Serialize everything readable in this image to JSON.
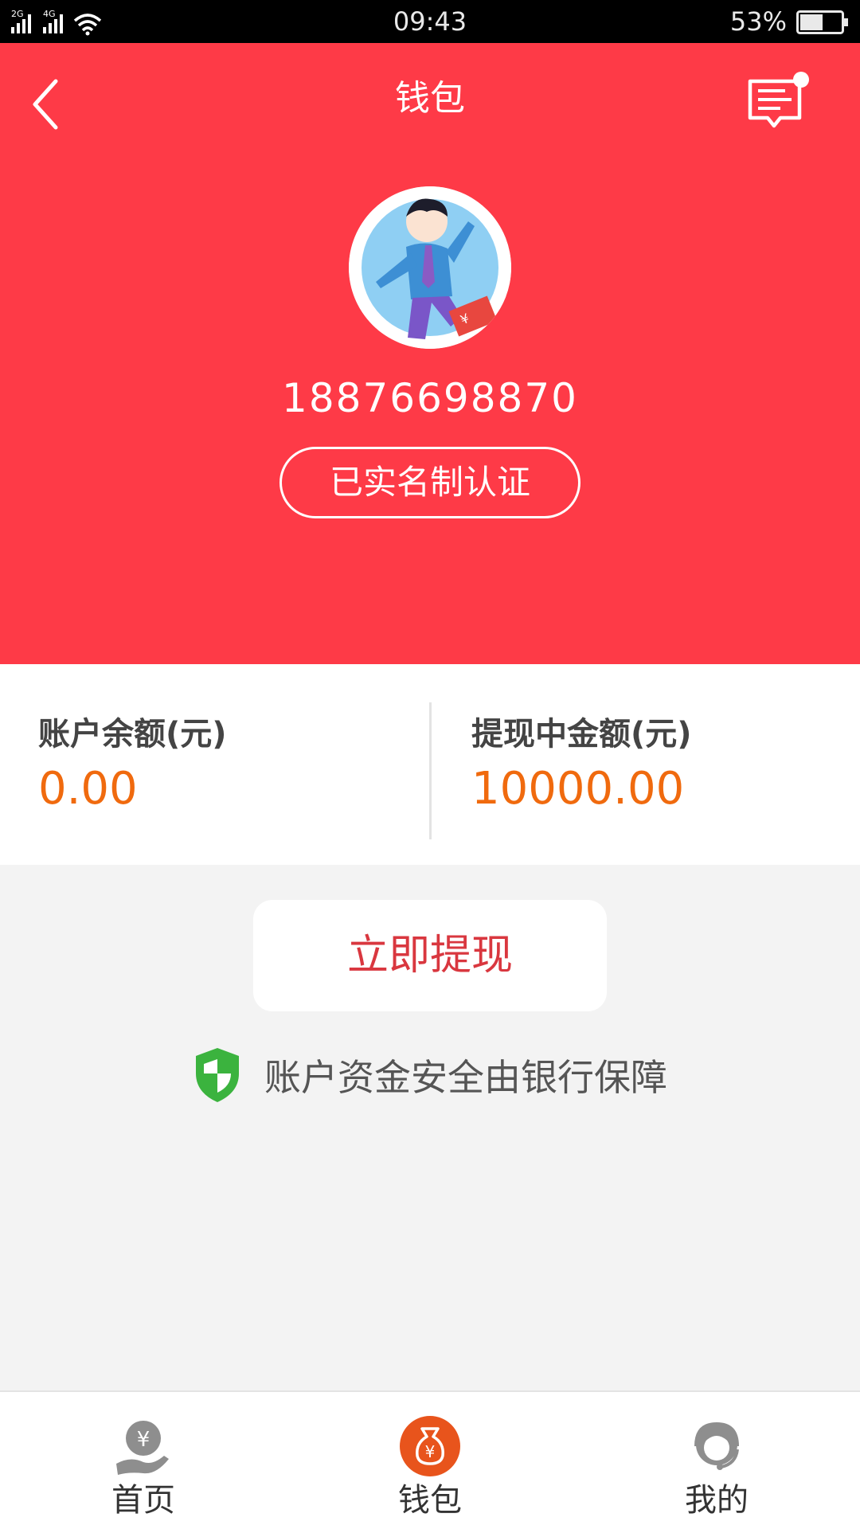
{
  "status_bar": {
    "signal_1": "2G",
    "signal_2": "4G",
    "time": "09:43",
    "battery_percent": "53%"
  },
  "header": {
    "title": "钱包",
    "phone": "18876698870",
    "verify_label": "已实名制认证"
  },
  "balance": {
    "account_label": "账户余额(元)",
    "account_value": "0.00",
    "withdrawing_label": "提现中金额(元)",
    "withdrawing_value": "10000.00"
  },
  "actions": {
    "withdraw_label": "立即提现"
  },
  "security": {
    "text": "账户资金安全由银行保障"
  },
  "tabbar": {
    "tabs": [
      {
        "label": "首页",
        "icon": "home-yuan-hand-icon",
        "active": false
      },
      {
        "label": "钱包",
        "icon": "wallet-moneybag-icon",
        "active": true
      },
      {
        "label": "我的",
        "icon": "profile-headset-icon",
        "active": false
      }
    ]
  },
  "colors": {
    "header_red": "#fe3a47",
    "amount_orange": "#f06a0e",
    "withdraw_text": "#d9373f",
    "active_tab": "#e8541c",
    "shield_green": "#3bb33e"
  }
}
